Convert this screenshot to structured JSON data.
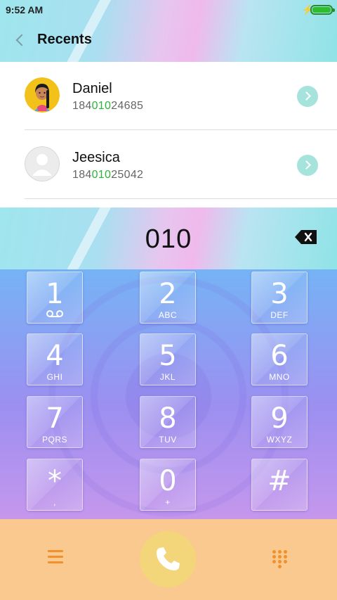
{
  "status_bar": {
    "time": "9:52 AM",
    "charging_icon": "bolt-icon",
    "battery_icon": "battery-full-icon",
    "battery_color": "#2ebd2e"
  },
  "header": {
    "title": "Recents",
    "back_icon": "chevron-left-icon"
  },
  "recents": [
    {
      "name": "Daniel",
      "number_prefix": "184",
      "number_match": "010",
      "number_suffix": "24685",
      "avatar": "girl-avatar"
    },
    {
      "name": "Jeesica",
      "number_prefix": "184",
      "number_match": "010",
      "number_suffix": "25042",
      "avatar": "default-avatar"
    }
  ],
  "dial": {
    "number": "010",
    "backspace_icon": "backspace-icon"
  },
  "keypad": [
    {
      "digit": "1",
      "letters": "",
      "extra": "voicemail-icon"
    },
    {
      "digit": "2",
      "letters": "ABC"
    },
    {
      "digit": "3",
      "letters": "DEF"
    },
    {
      "digit": "4",
      "letters": "GHI"
    },
    {
      "digit": "5",
      "letters": "JKL"
    },
    {
      "digit": "6",
      "letters": "MNO"
    },
    {
      "digit": "7",
      "letters": "PQRS"
    },
    {
      "digit": "8",
      "letters": "TUV"
    },
    {
      "digit": "9",
      "letters": "WXYZ"
    },
    {
      "digit": "*",
      "letters": ","
    },
    {
      "digit": "0",
      "letters": "+"
    },
    {
      "digit": "#",
      "letters": ""
    }
  ],
  "bottom_bar": {
    "menu_icon": "menu-icon",
    "call_icon": "phone-icon",
    "keypad_icon": "dialpad-icon",
    "accent": "#f0912c",
    "call_color": "#f3d57a"
  },
  "colors": {
    "match_highlight": "#2ab43b",
    "arrow_bg": "#a6e3dc"
  }
}
